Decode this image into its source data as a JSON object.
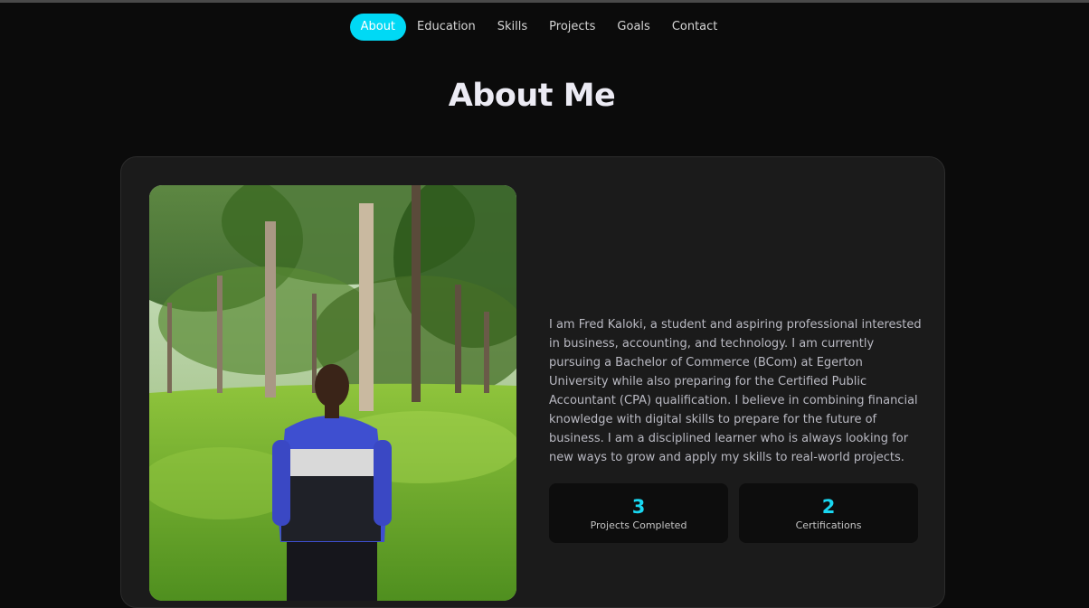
{
  "nav": {
    "items": [
      {
        "label": "About",
        "active": true
      },
      {
        "label": "Education",
        "active": false
      },
      {
        "label": "Skills",
        "active": false
      },
      {
        "label": "Projects",
        "active": false
      },
      {
        "label": "Goals",
        "active": false
      },
      {
        "label": "Contact",
        "active": false
      }
    ]
  },
  "section": {
    "title": "About Me"
  },
  "about": {
    "bio": "I am Fred Kaloki, a student and aspiring professional interested in business, accounting, and technology. I am currently pursuing a Bachelor of Commerce (BCom) at Egerton University while also preparing for the Certified Public Accountant (CPA) qualification. I believe in combining financial knowledge with digital skills to prepare for the future of business. I am a disciplined learner who is always looking for new ways to grow and apply my skills to real-world projects.",
    "stats": [
      {
        "value": "3",
        "label": "Projects Completed"
      },
      {
        "value": "2",
        "label": "Certifications"
      }
    ]
  },
  "colors": {
    "accent": "#00d9f5",
    "background": "#0b0b0b",
    "card": "#1b1b1b"
  }
}
